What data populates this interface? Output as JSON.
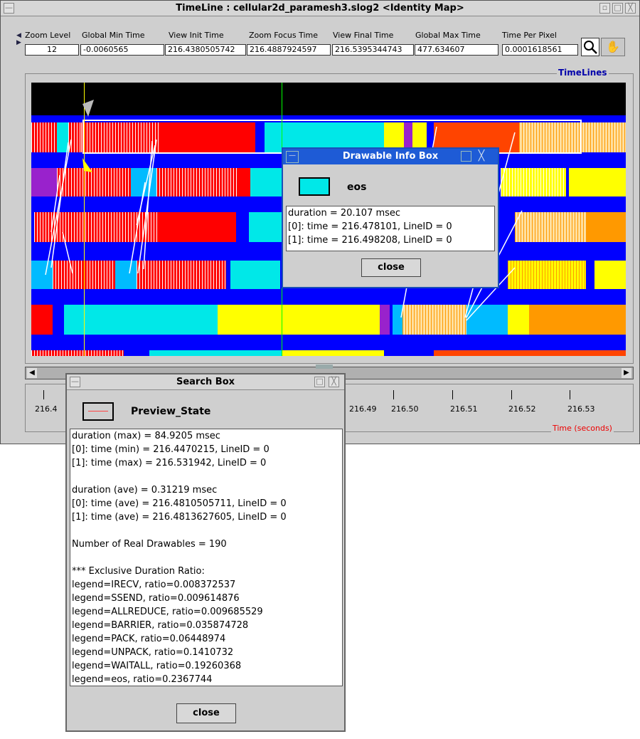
{
  "main_window": {
    "title": "TimeLine : cellular2d_paramesh3.slog2  <Identity Map>",
    "fields": [
      {
        "label": "Zoom Level",
        "value": "12"
      },
      {
        "label": "Global Min Time",
        "value": "-0.0060565"
      },
      {
        "label": "View Init Time",
        "value": "216.4380505742"
      },
      {
        "label": "Zoom Focus Time",
        "value": "216.4887924597"
      },
      {
        "label": "View Final Time",
        "value": "216.5395344743"
      },
      {
        "label": "Global Max Time",
        "value": "477.634607"
      },
      {
        "label": "Time Per Pixel",
        "value": "0.0001618561"
      }
    ],
    "timelines_label": "TimeLines",
    "time_axis_label": "Time (seconds)",
    "axis_ticks": [
      "216.4",
      "216.49",
      "216.50",
      "216.51",
      "216.52",
      "216.53"
    ]
  },
  "info_box": {
    "title": "Drawable Info Box",
    "swatch_color": "#00e8e8",
    "legend_name": "eos",
    "lines": [
      "duration = 20.107 msec",
      "[0]: time = 216.478101, LineID = 0",
      "[1]: time = 216.498208, LineID = 0"
    ],
    "close_label": "close"
  },
  "search_box": {
    "title": "Search Box",
    "legend_name": "Preview_State",
    "lines": [
      "duration (max) = 84.9205 msec",
      "[0]: time (min) = 216.4470215, LineID = 0",
      "[1]: time (max) = 216.531942, LineID = 0",
      "",
      "duration (ave) = 0.31219 msec",
      "[0]: time (ave) = 216.4810505711, LineID = 0",
      "[1]: time (ave) = 216.4813627605, LineID = 0",
      "",
      "Number of Real Drawables = 190",
      "",
      "*** Exclusive Duration Ratio:",
      "legend=IRECV, ratio=0.008372537",
      "legend=SSEND, ratio=0.009614876",
      "legend=ALLREDUCE, ratio=0.009685529",
      "legend=BARRIER, ratio=0.035874728",
      "legend=PACK, ratio=0.06448974",
      "legend=UNPACK, ratio=0.1410732",
      "legend=WAITALL, ratio=0.19260368",
      "legend=eos, ratio=0.2367744"
    ],
    "close_label": "close"
  },
  "colors": {
    "background_blue": "#0000ff",
    "red": "#ff0000",
    "cyan": "#00e8e8",
    "yellow": "#ffff00",
    "orange": "#ff9900",
    "orange_red": "#ff4400",
    "purple": "#9922cc",
    "light_blue": "#00bbff"
  }
}
